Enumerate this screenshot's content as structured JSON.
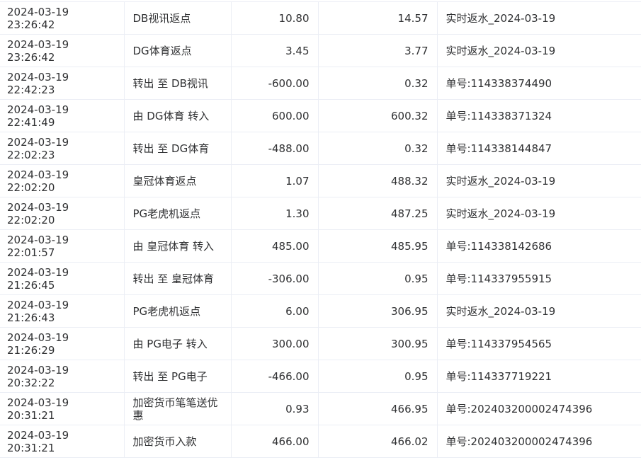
{
  "rows": [
    {
      "time": "2024-03-19 23:26:42",
      "type": "DB视讯返点",
      "amount": "10.80",
      "balance": "14.57",
      "note": "实时返水_2024-03-19"
    },
    {
      "time": "2024-03-19 23:26:42",
      "type": "DG体育返点",
      "amount": "3.45",
      "balance": "3.77",
      "note": "实时返水_2024-03-19"
    },
    {
      "time": "2024-03-19 22:42:23",
      "type": "转出 至 DB视讯",
      "amount": "-600.00",
      "balance": "0.32",
      "note": "单号:114338374490"
    },
    {
      "time": "2024-03-19 22:41:49",
      "type": "由 DG体育 转入",
      "amount": "600.00",
      "balance": "600.32",
      "note": "单号:114338371324"
    },
    {
      "time": "2024-03-19 22:02:23",
      "type": "转出 至 DG体育",
      "amount": "-488.00",
      "balance": "0.32",
      "note": "单号:114338144847"
    },
    {
      "time": "2024-03-19 22:02:20",
      "type": "皇冠体育返点",
      "amount": "1.07",
      "balance": "488.32",
      "note": "实时返水_2024-03-19"
    },
    {
      "time": "2024-03-19 22:02:20",
      "type": "PG老虎机返点",
      "amount": "1.30",
      "balance": "487.25",
      "note": "实时返水_2024-03-19"
    },
    {
      "time": "2024-03-19 22:01:57",
      "type": "由 皇冠体育 转入",
      "amount": "485.00",
      "balance": "485.95",
      "note": "单号:114338142686"
    },
    {
      "time": "2024-03-19 21:26:45",
      "type": "转出 至 皇冠体育",
      "amount": "-306.00",
      "balance": "0.95",
      "note": "单号:114337955915"
    },
    {
      "time": "2024-03-19 21:26:43",
      "type": "PG老虎机返点",
      "amount": "6.00",
      "balance": "306.95",
      "note": "实时返水_2024-03-19"
    },
    {
      "time": "2024-03-19 21:26:29",
      "type": "由 PG电子 转入",
      "amount": "300.00",
      "balance": "300.95",
      "note": "单号:114337954565"
    },
    {
      "time": "2024-03-19 20:32:22",
      "type": "转出 至 PG电子",
      "amount": "-466.00",
      "balance": "0.95",
      "note": "单号:114337719221"
    },
    {
      "time": "2024-03-19 20:31:21",
      "type": "加密货币笔笔送优惠",
      "amount": "0.93",
      "balance": "466.95",
      "note": "单号:202403200002474396"
    },
    {
      "time": "2024-03-19 20:31:21",
      "type": "加密货币入款",
      "amount": "466.00",
      "balance": "466.02",
      "note": "单号:202403200002474396"
    }
  ]
}
